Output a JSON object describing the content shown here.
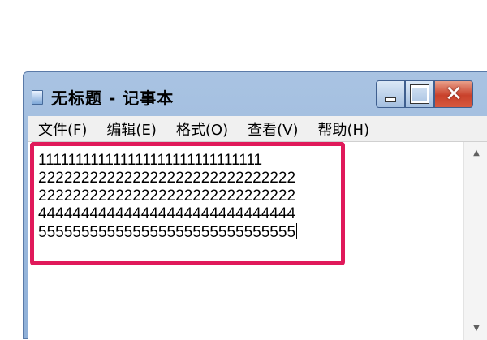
{
  "window": {
    "title": "无标题 - 记事本",
    "controls": {
      "minimize_icon": "minimize-icon",
      "maximize_icon": "maximize-icon",
      "close_icon": "close-icon",
      "close_glyph": "✕"
    }
  },
  "menu": {
    "items": [
      {
        "text": "文件(",
        "key": "F",
        "end": ")"
      },
      {
        "text": "编辑(",
        "key": "E",
        "end": ")"
      },
      {
        "text": "格式(",
        "key": "O",
        "end": ")"
      },
      {
        "text": "查看(",
        "key": "V",
        "end": ")"
      },
      {
        "text": "帮助(",
        "key": "H",
        "end": ")"
      }
    ]
  },
  "editor": {
    "lines": [
      "111111111111111111111111111111",
      "222222222222222222222222222222",
      "222222222222222222222222222222",
      "444444444444444444444444444444",
      "555555555555555555555555555555"
    ],
    "highlight_color": "#e0195a"
  },
  "scrollbar": {
    "up_arrow": "▲",
    "down_arrow": "▼"
  }
}
